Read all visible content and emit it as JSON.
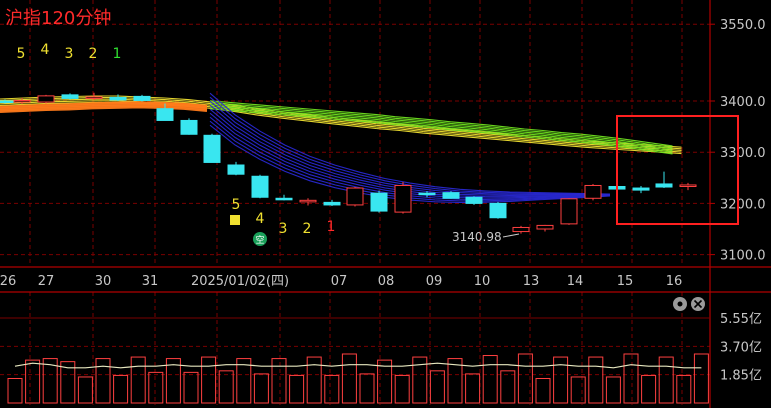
{
  "title": "沪指120分钟",
  "chart_data": {
    "type": "candlestick",
    "price_axis": {
      "ticks": [
        3550.0,
        3400.0,
        3300.0,
        3200.0,
        3100.0
      ],
      "labels": [
        "3550.0",
        "3400.0",
        "3300.0",
        "3200.0",
        "3100.0"
      ]
    },
    "volume_axis": {
      "ticks": [
        5.55,
        3.7,
        1.85
      ],
      "labels": [
        "5.55亿",
        "3.70亿",
        "1.85亿"
      ]
    },
    "date_labels": [
      "26",
      "27",
      "30",
      "31",
      "2025/01/02(四)",
      "07",
      "08",
      "09",
      "10",
      "13",
      "14",
      "15",
      "16"
    ],
    "candles": [
      {
        "o": 3400,
        "h": 3403,
        "l": 3395,
        "c": 3398
      },
      {
        "o": 3398,
        "h": 3406,
        "l": 3394,
        "c": 3401
      },
      {
        "o": 3398,
        "h": 3412,
        "l": 3395,
        "c": 3410
      },
      {
        "o": 3412,
        "h": 3415,
        "l": 3403,
        "c": 3405
      },
      {
        "o": 3405,
        "h": 3416,
        "l": 3402,
        "c": 3408
      },
      {
        "o": 3407,
        "h": 3413,
        "l": 3400,
        "c": 3402
      },
      {
        "o": 3409,
        "h": 3412,
        "l": 3399,
        "c": 3401
      },
      {
        "o": 3385,
        "h": 3395,
        "l": 3362,
        "c": 3362
      },
      {
        "o": 3362,
        "h": 3366,
        "l": 3334,
        "c": 3335
      },
      {
        "o": 3333,
        "h": 3336,
        "l": 3280,
        "c": 3280
      },
      {
        "o": 3275,
        "h": 3281,
        "l": 3255,
        "c": 3257
      },
      {
        "o": 3253,
        "h": 3256,
        "l": 3210,
        "c": 3212
      },
      {
        "o": 3210,
        "h": 3217,
        "l": 3206,
        "c": 3207
      },
      {
        "o": 3203,
        "h": 3210,
        "l": 3196,
        "c": 3206
      },
      {
        "o": 3202,
        "h": 3207,
        "l": 3195,
        "c": 3197
      },
      {
        "o": 3197,
        "h": 3232,
        "l": 3194,
        "c": 3230
      },
      {
        "o": 3220,
        "h": 3225,
        "l": 3182,
        "c": 3185
      },
      {
        "o": 3183,
        "h": 3242,
        "l": 3180,
        "c": 3235
      },
      {
        "o": 3220,
        "h": 3224,
        "l": 3212,
        "c": 3218
      },
      {
        "o": 3221,
        "h": 3224,
        "l": 3209,
        "c": 3210
      },
      {
        "o": 3212,
        "h": 3214,
        "l": 3197,
        "c": 3200
      },
      {
        "o": 3200,
        "h": 3203,
        "l": 3170,
        "c": 3172
      },
      {
        "o": 3145,
        "h": 3156,
        "l": 3141,
        "c": 3153
      },
      {
        "o": 3150,
        "h": 3158,
        "l": 3145,
        "c": 3157
      },
      {
        "o": 3160,
        "h": 3210,
        "l": 3158,
        "c": 3209
      },
      {
        "o": 3210,
        "h": 3238,
        "l": 3206,
        "c": 3235
      },
      {
        "o": 3233,
        "h": 3237,
        "l": 3224,
        "c": 3228
      },
      {
        "o": 3230,
        "h": 3234,
        "l": 3220,
        "c": 3226
      },
      {
        "o": 3238,
        "h": 3262,
        "l": 3230,
        "c": 3232
      },
      {
        "o": 3233,
        "h": 3240,
        "l": 3226,
        "c": 3236
      }
    ],
    "volumes": [
      1.6,
      2.8,
      2.9,
      2.7,
      1.7,
      2.9,
      1.8,
      3.0,
      2.0,
      2.9,
      2.0,
      3.0,
      2.1,
      2.9,
      1.9,
      2.9,
      1.8,
      3.0,
      1.8,
      3.2,
      1.9,
      2.8,
      1.8,
      3.0,
      2.1,
      2.9,
      1.9,
      3.1,
      2.1,
      3.2,
      1.6,
      3.0,
      1.7,
      3.0,
      1.7,
      3.2,
      1.8,
      3.0,
      1.8,
      3.2
    ],
    "volume_ma": [
      2.4,
      2.6,
      2.5,
      2.3,
      2.3,
      2.4,
      2.3,
      2.4,
      2.4,
      2.5,
      2.4,
      2.4,
      2.5,
      2.5,
      2.4,
      2.4,
      2.4,
      2.5,
      2.4,
      2.5,
      2.5,
      2.4,
      2.4,
      2.5,
      2.6,
      2.5,
      2.4,
      2.5,
      2.5,
      2.4,
      2.4,
      2.5,
      2.4,
      2.4,
      2.3,
      2.5,
      2.4,
      2.4,
      2.3,
      2.3
    ],
    "ma_groups": [
      {
        "color": "#F0E030",
        "line_count": 5,
        "values": [
          3396,
          3398,
          3400,
          3401,
          3402,
          3402,
          3400,
          3398,
          3395,
          3390,
          3384,
          3377,
          3371,
          3366,
          3361,
          3356,
          3351,
          3347,
          3342,
          3338,
          3334,
          3330,
          3326,
          3322,
          3318,
          3314,
          3311,
          3308,
          3305,
          3302
        ]
      },
      {
        "color": "#FF7A1A",
        "line_count": 4,
        "values": [
          3382,
          3384,
          3386,
          3387,
          3389,
          3390,
          3391,
          3390,
          3388,
          3384
        ]
      },
      {
        "color": "#6FE020",
        "line_count": 6,
        "values": [
          3391,
          3388,
          3385,
          3382,
          3379,
          3376,
          3373,
          3370,
          3367,
          3364,
          3360,
          3357,
          3354,
          3350,
          3347,
          3344,
          3340,
          3336,
          3333,
          3329,
          3326,
          3322,
          3318,
          3313,
          3308,
          3303
        ]
      },
      {
        "color": "#2828D0",
        "line_count": 9,
        "values": [
          3380,
          3340,
          3310,
          3285,
          3265,
          3250,
          3238,
          3228,
          3221,
          3216,
          3213,
          3212,
          3212,
          3213,
          3214,
          3215,
          3216
        ]
      }
    ],
    "ma_periods": [
      "5",
      "4",
      "3",
      "2",
      "1"
    ],
    "signal_periods": [
      "5",
      "4",
      "3",
      "2",
      "1"
    ],
    "annotations": [
      {
        "text": "3140.98"
      },
      {
        "text": "空"
      }
    ],
    "highlight_box": {
      "note": "red rectangle around last candles"
    }
  }
}
